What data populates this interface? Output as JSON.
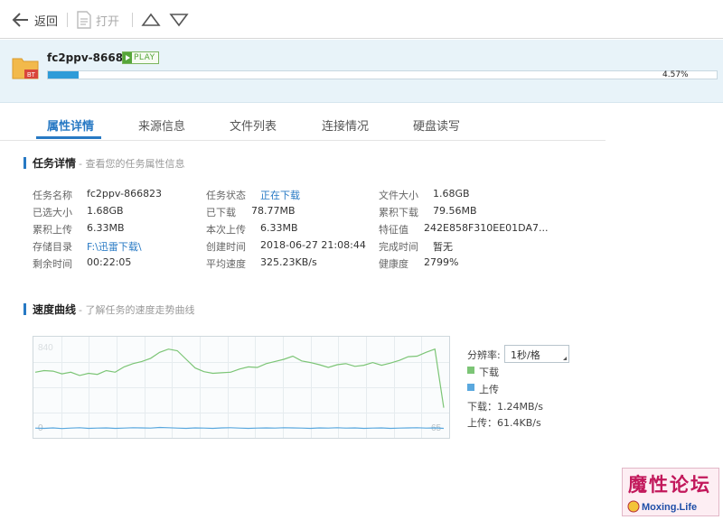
{
  "toolbar": {
    "back_label": "返回",
    "open_label": "打开"
  },
  "task": {
    "name": "fc2ppv-866823",
    "play_label": "PLAY",
    "folder_badge": "BT",
    "progress_fraction": 0.0457,
    "progress_text": "4.57%"
  },
  "tabs": [
    {
      "label": "属性详情",
      "active": true
    },
    {
      "label": "来源信息",
      "active": false
    },
    {
      "label": "文件列表",
      "active": false
    },
    {
      "label": "连接情况",
      "active": false
    },
    {
      "label": "硬盘读写",
      "active": false
    }
  ],
  "details": {
    "title": "任务详情",
    "subtitle": "- 查看您的任务属性信息",
    "col1": [
      {
        "label": "任务名称",
        "value": "fc2ppv-866823"
      },
      {
        "label": "已选大小",
        "value": "1.68GB"
      },
      {
        "label": "累积上传",
        "value": "6.33MB"
      },
      {
        "label": "存储目录",
        "value": "F:\\迅雷下载\\"
      },
      {
        "label": "剩余时间",
        "value": "00:22:05"
      }
    ],
    "col2": [
      {
        "label": "任务状态",
        "value": "正在下载"
      },
      {
        "label": "已下载",
        "value": "78.77MB"
      },
      {
        "label": "本次上传",
        "value": "6.33MB"
      },
      {
        "label": "创建时间",
        "value": "2018-06-27 21:08:44"
      },
      {
        "label": "平均速度",
        "value": "325.23KB/s"
      }
    ],
    "col3": [
      {
        "label": "文件大小",
        "value": "1.68GB"
      },
      {
        "label": "累积下载",
        "value": "79.56MB"
      },
      {
        "label": "特征值",
        "value": "242E858F310EE01DA7..."
      },
      {
        "label": "完成时间",
        "value": "暂无"
      },
      {
        "label": "健康度",
        "value": "2799%"
      }
    ]
  },
  "speed": {
    "title": "速度曲线",
    "subtitle": "- 了解任务的速度走势曲线",
    "y_max_label": "840",
    "y_min_label": "0",
    "right_label": "65",
    "resolution_label": "分辨率:",
    "resolution_value": "1秒/格",
    "legend_download": "下载",
    "legend_upload": "上传",
    "download_rate": "下载：1.24MB/s",
    "upload_rate": "上传：61.4KB/s",
    "download_color": "#7cc576",
    "upload_color": "#5aa8de"
  },
  "chart_data": {
    "type": "line",
    "ylim": [
      0,
      840
    ],
    "series": [
      {
        "name": "下载",
        "values": [
          560,
          575,
          570,
          545,
          560,
          530,
          550,
          540,
          575,
          560,
          610,
          640,
          660,
          690,
          745,
          775,
          760,
          680,
          600,
          565,
          550,
          555,
          560,
          590,
          610,
          605,
          640,
          660,
          680,
          710,
          665,
          650,
          630,
          605,
          630,
          640,
          615,
          625,
          650,
          625,
          645,
          670,
          705,
          710,
          745,
          775,
          230
        ]
      },
      {
        "name": "上传",
        "values": [
          40,
          38,
          42,
          36,
          40,
          44,
          38,
          40,
          42,
          38,
          40,
          44,
          42,
          40,
          46,
          44,
          40,
          38,
          42,
          40,
          38,
          42,
          44,
          40,
          38,
          40,
          42,
          40,
          44,
          42,
          40,
          38,
          42,
          40,
          44,
          40,
          42,
          38,
          40,
          42,
          38,
          40,
          42,
          44,
          40,
          42,
          38
        ]
      }
    ]
  }
}
